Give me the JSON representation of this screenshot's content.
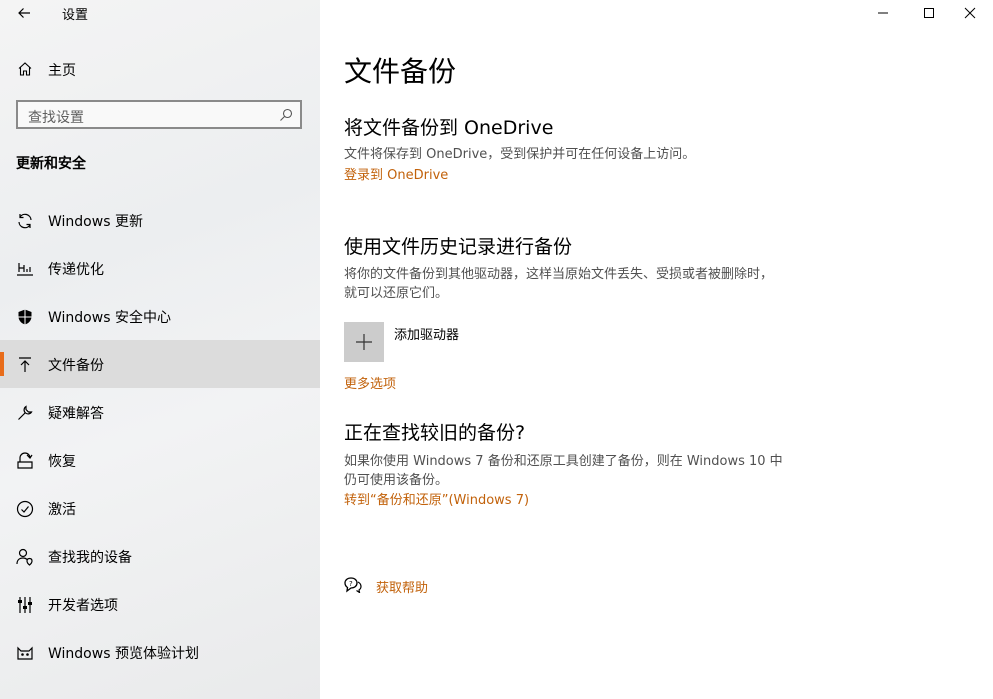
{
  "window": {
    "title": "设置",
    "controls": [
      "minimize",
      "maximize",
      "close"
    ]
  },
  "sidebar": {
    "home_label": "主页",
    "search_placeholder": "查找设置",
    "section_title": "更新和安全",
    "items": [
      {
        "label": "Windows 更新",
        "icon": "sync-icon"
      },
      {
        "label": "传递优化",
        "icon": "delivery-optimization-icon"
      },
      {
        "label": "Windows 安全中心",
        "icon": "shield-icon"
      },
      {
        "label": "文件备份",
        "icon": "backup-arrow-icon",
        "selected": true
      },
      {
        "label": "疑难解答",
        "icon": "wrench-icon"
      },
      {
        "label": "恢复",
        "icon": "recovery-icon"
      },
      {
        "label": "激活",
        "icon": "check-circle-icon"
      },
      {
        "label": "查找我的设备",
        "icon": "person-location-icon"
      },
      {
        "label": "开发者选项",
        "icon": "developer-sliders-icon"
      },
      {
        "label": "Windows 预览体验计划",
        "icon": "insider-cat-icon"
      }
    ]
  },
  "main": {
    "page_title": "文件备份",
    "onedrive": {
      "heading": "将文件备份到 OneDrive",
      "description": "文件将保存到 OneDrive，受到保护并可在任何设备上访问。",
      "link": "登录到 OneDrive"
    },
    "file_history": {
      "heading": "使用文件历史记录进行备份",
      "description": "将你的文件备份到其他驱动器，这样当原始文件丢失、受损或者被删除时，就可以还原它们。",
      "add_drive_label": "添加驱动器",
      "more_options": "更多选项"
    },
    "older_backup": {
      "heading": "正在查找较旧的备份?",
      "description": "如果你使用 Windows 7 备份和还原工具创建了备份，则在 Windows 10 中仍可使用该备份。",
      "link": "转到“备份和还原”(Windows 7)"
    },
    "help_link": "获取帮助"
  },
  "colors": {
    "accent": "#c2620b",
    "selection_bar": "#e86c1a",
    "selected_bg": "#dcdcdc"
  }
}
